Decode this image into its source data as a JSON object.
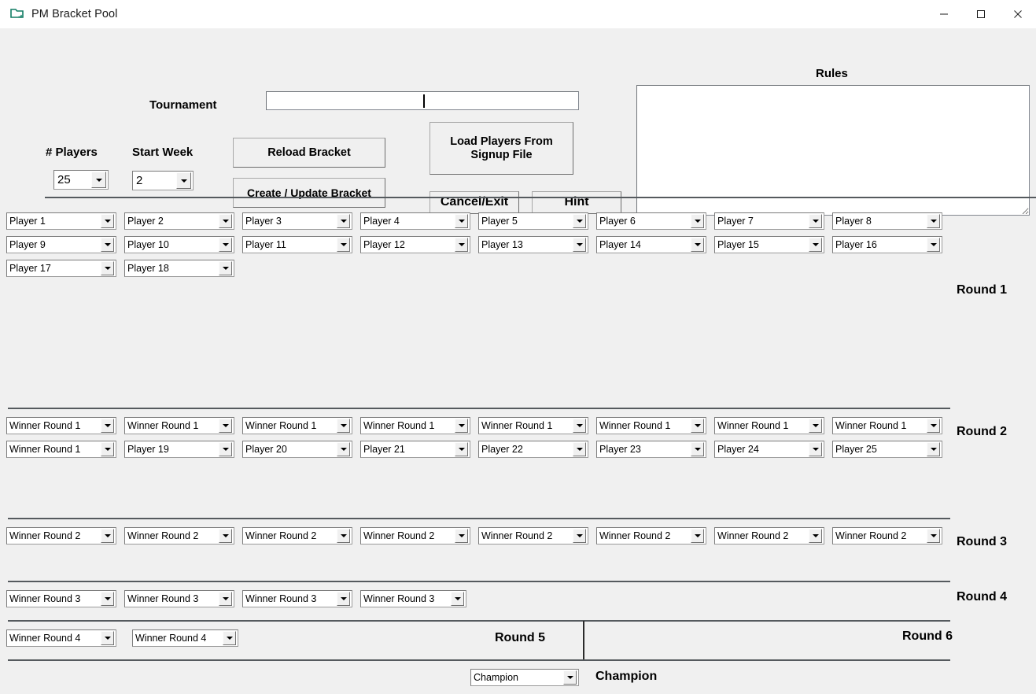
{
  "window": {
    "title": "PM Bracket Pool",
    "icon": "folder-shortcut-icon",
    "minimize_label": "—",
    "maximize_label": "☐",
    "close_label": "✕"
  },
  "header": {
    "tournament_label": "Tournament",
    "tournament_value": "",
    "tournament_placeholder": "",
    "players_label": "# Players",
    "players_value": "25",
    "startweek_label": "Start Week",
    "startweek_value": "2",
    "rules_label": "Rules",
    "rules_value": "",
    "buttons": {
      "reload": "Reload Bracket",
      "create": "Create / Update Bracket",
      "load_line1": "Load Players From",
      "load_line2": "Signup File",
      "cancel": "Cancel/Exit",
      "hint": "Hint"
    }
  },
  "rounds": [
    {
      "label": "Round 1",
      "rows": [
        [
          "Player 1",
          "Player 2",
          "Player 3",
          "Player 4",
          "Player 5",
          "Player 6",
          "Player 7",
          "Player 8"
        ],
        [
          "Player 9",
          "Player 10",
          "Player 11",
          "Player 12",
          "Player 13",
          "Player 14",
          "Player 15",
          "Player 16"
        ],
        [
          "Player 17",
          "Player 18"
        ]
      ]
    },
    {
      "label": "Round 2",
      "rows": [
        [
          "Winner Round 1",
          "Winner Round 1",
          "Winner Round 1",
          "Winner Round 1",
          "Winner Round 1",
          "Winner Round 1",
          "Winner Round 1",
          "Winner Round 1"
        ],
        [
          "Winner Round 1",
          "Player 19",
          "Player 20",
          "Player 21",
          "Player 22",
          "Player 23",
          "Player 24",
          "Player 25"
        ]
      ]
    },
    {
      "label": "Round 3",
      "rows": [
        [
          "Winner Round 2",
          "Winner Round 2",
          "Winner Round 2",
          "Winner Round 2",
          "Winner Round 2",
          "Winner Round 2",
          "Winner Round 2",
          "Winner Round 2"
        ]
      ]
    },
    {
      "label": "Round 4",
      "rows": [
        [
          "Winner Round 3",
          "Winner Round 3",
          "Winner Round 3",
          "Winner Round 3"
        ]
      ]
    },
    {
      "label": "Round 5",
      "rows": [
        [
          "Winner Round 4",
          "Winner Round 4"
        ]
      ]
    },
    {
      "label": "Round 6",
      "rows": []
    }
  ],
  "champion": {
    "value": "Champion",
    "label": "Champion"
  }
}
